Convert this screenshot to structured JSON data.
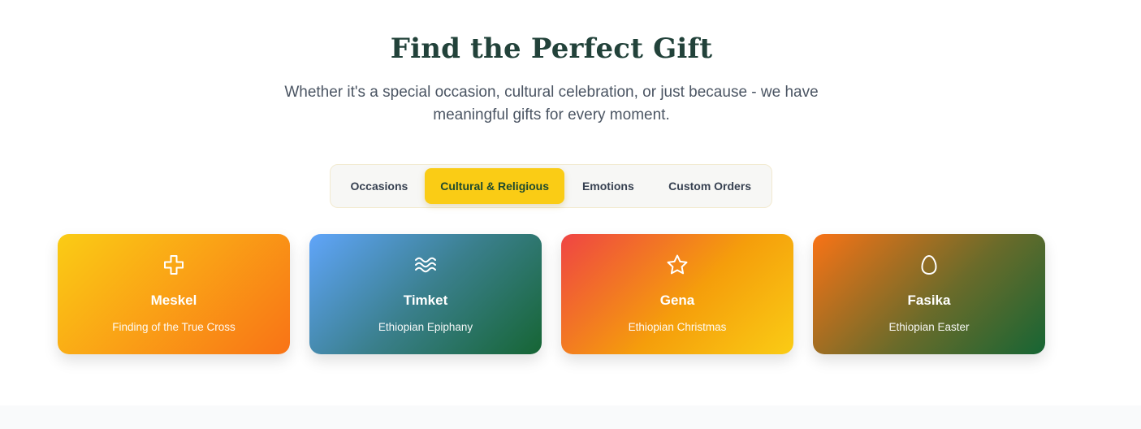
{
  "header": {
    "title": "Find the Perfect Gift",
    "subtitle": "Whether it's a special occasion, cultural celebration, or just because - we have meaningful gifts for every moment."
  },
  "tabs": [
    {
      "label": "Occasions",
      "active": false
    },
    {
      "label": "Cultural & Religious",
      "active": true
    },
    {
      "label": "Emotions",
      "active": false
    },
    {
      "label": "Custom Orders",
      "active": false
    }
  ],
  "cards": [
    {
      "title": "Meskel",
      "subtitle": "Finding of the True Cross",
      "icon": "cross-icon"
    },
    {
      "title": "Timket",
      "subtitle": "Ethiopian Epiphany",
      "icon": "waves-icon"
    },
    {
      "title": "Gena",
      "subtitle": "Ethiopian Christmas",
      "icon": "star-icon"
    },
    {
      "title": "Fasika",
      "subtitle": "Ethiopian Easter",
      "icon": "egg-icon"
    }
  ],
  "colors": {
    "accent": "#facc15",
    "title": "#22423a",
    "active_tab_text": "#1f4a2e"
  }
}
